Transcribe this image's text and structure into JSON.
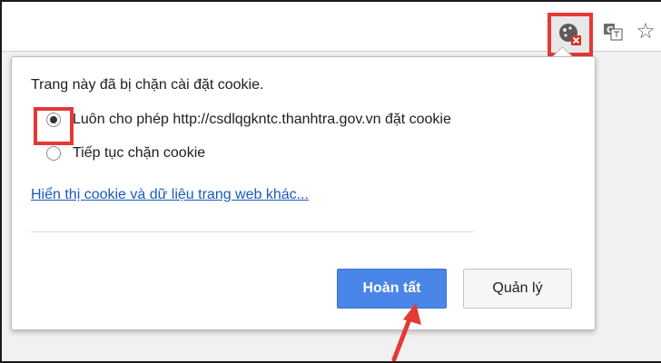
{
  "toolbar": {
    "icons": {
      "cookie_blocked": "cookie-blocked-icon",
      "translate": "translate-icon",
      "bookmark_star": "bookmark-star-icon"
    },
    "star_glyph": "☆"
  },
  "popup": {
    "title": "Trang này đã bị chặn cài đặt cookie.",
    "options": [
      {
        "label": "Luôn cho phép http://csdlqgkntc.thanhtra.gov.vn đặt cookie",
        "selected": true
      },
      {
        "label": "Tiếp tục chặn cookie",
        "selected": false
      }
    ],
    "link": "Hiển thị cookie và dữ liệu trang web khác...",
    "buttons": {
      "done": "Hoàn tất",
      "manage": "Quản lý"
    }
  },
  "colors": {
    "annotation": "#e53935",
    "primary_button": "#4a86e8",
    "link": "#1a5ab8"
  }
}
